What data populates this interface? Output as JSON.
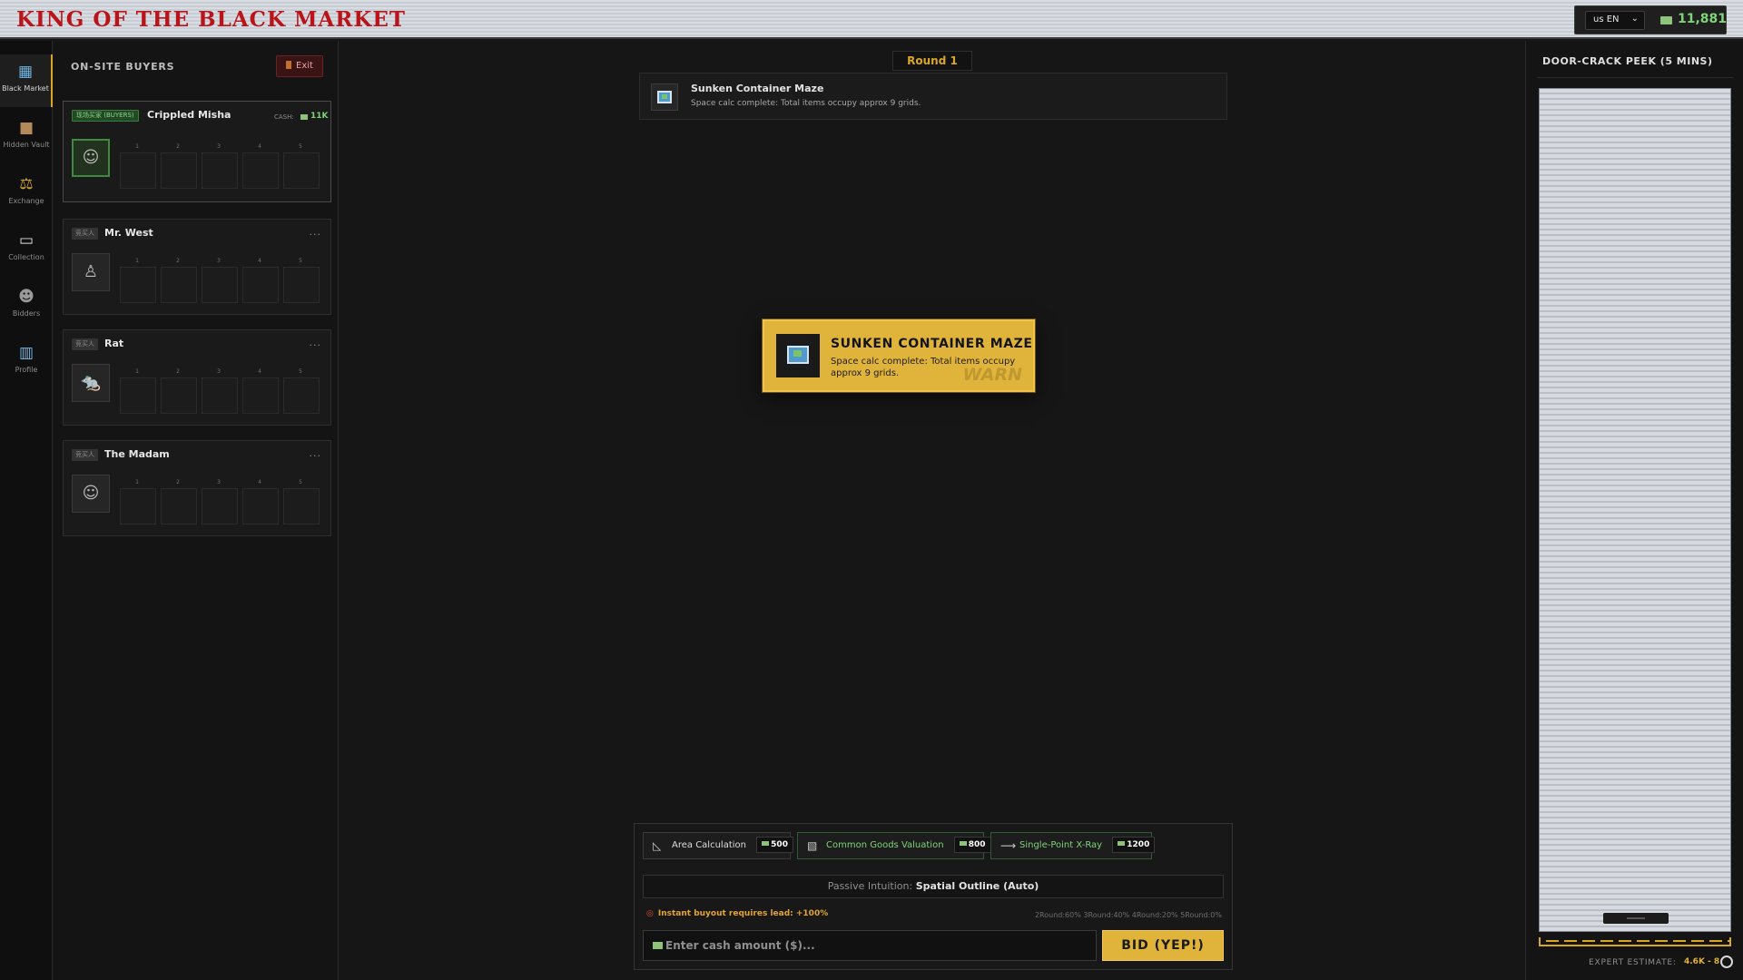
{
  "header": {
    "title": "KING OF THE BLACK MARKET",
    "language": "us EN",
    "cash": "11,881"
  },
  "nav": {
    "items": [
      {
        "label": "Black Market",
        "icon": "map-icon",
        "active": true
      },
      {
        "label": "Hidden Vault",
        "icon": "box-icon"
      },
      {
        "label": "Exchange",
        "icon": "scale-icon"
      },
      {
        "label": "Collection",
        "icon": "book-icon"
      },
      {
        "label": "Bidders",
        "icon": "people-icon"
      },
      {
        "label": "Profile",
        "icon": "chart-icon"
      }
    ]
  },
  "buyers": {
    "title": "ON-SITE BUYERS",
    "exit_label": "Exit",
    "list": [
      {
        "tag": "现场买家 (BUYERS)",
        "name": "Crippled Misha",
        "cash_label": "CASH:",
        "cash": "11K",
        "avatar": "misha-avatar-icon",
        "slots": [
          "1",
          "2",
          "3",
          "4",
          "5"
        ]
      },
      {
        "tag": "竞买人",
        "name": "Mr. West",
        "more": "...",
        "avatar": "west-avatar-icon",
        "slots": [
          "1",
          "2",
          "3",
          "4",
          "5"
        ]
      },
      {
        "tag": "竞买人",
        "name": "Rat",
        "more": "...",
        "avatar": "rat-avatar-icon",
        "slots": [
          "1",
          "2",
          "3",
          "4",
          "5"
        ]
      },
      {
        "tag": "竞买人",
        "name": "The Madam",
        "more": "...",
        "avatar": "madam-avatar-icon",
        "slots": [
          "1",
          "2",
          "3",
          "4",
          "5"
        ]
      }
    ]
  },
  "round": {
    "label": "Round 1"
  },
  "item": {
    "title": "Sunken Container Maze",
    "subtitle": "Space calc complete: Total items occupy approx 9 grids."
  },
  "toast": {
    "title": "SUNKEN CONTAINER MAZE",
    "body": "Space calc complete: Total items occupy approx 9 grids.",
    "watermark": "WARN"
  },
  "tools": [
    {
      "label": "Area Calculation",
      "price": "500",
      "icon": "ruler-icon"
    },
    {
      "label": "Common Goods Valuation",
      "price": "800",
      "icon": "chart-icon"
    },
    {
      "label": "Single-Point X-Ray",
      "price": "1200",
      "icon": "arrow-icon"
    }
  ],
  "passive": {
    "label": "Passive Intuition:",
    "value": "Spatial Outline (Auto)"
  },
  "buyout_note": "Instant buyout requires lead: +100%",
  "round_odds": "2Round:60% 3Round:40% 4Round:20% 5Round:0%",
  "bid": {
    "placeholder": "Enter cash amount ($)...",
    "button": "BID (YEP!)"
  },
  "peek": {
    "title": "DOOR-CRACK PEEK (5 MINS)",
    "expert_label": "EXPERT ESTIMATE:",
    "expert_value": "4.6K - 8"
  }
}
